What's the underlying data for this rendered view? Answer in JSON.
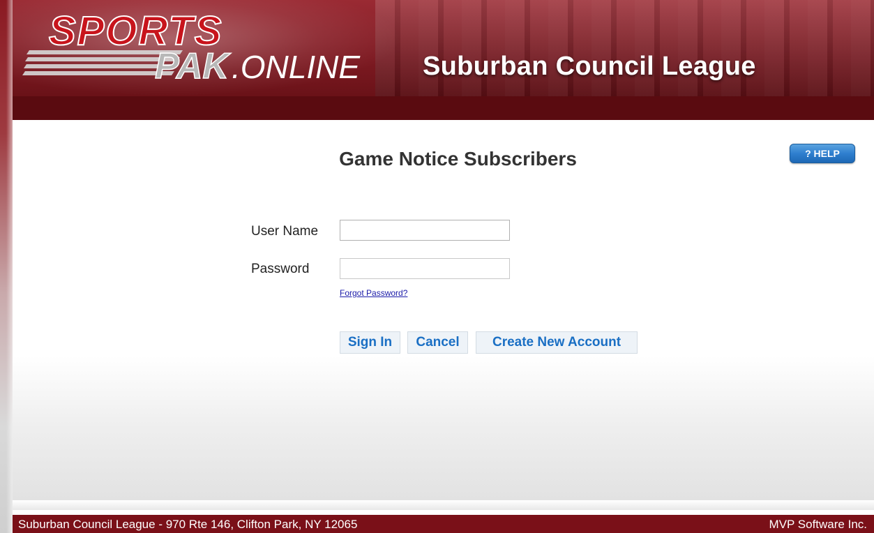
{
  "header": {
    "logo": {
      "line1": "SPORTS",
      "line2_a": "PAK",
      "line2_b": ".ONLINE"
    },
    "league_title": "Suburban Council League"
  },
  "main": {
    "page_title": "Game Notice Subscribers",
    "help_label": "? HELP",
    "form": {
      "username_label": "User Name",
      "username_value": "",
      "password_label": "Password",
      "password_value": "",
      "forgot_password": "Forgot Password?"
    },
    "buttons": {
      "sign_in": "Sign In",
      "cancel": "Cancel",
      "create_account": "Create New Account"
    }
  },
  "footer": {
    "address": "Suburban Council League - 970 Rte 146, Clifton Park, NY 12065",
    "vendor": "MVP Software Inc."
  },
  "colors": {
    "brand_red": "#7a1018",
    "header_dark": "#5a0b10",
    "link_blue": "#1a6fc4",
    "help_blue": "#2f7fcf"
  }
}
